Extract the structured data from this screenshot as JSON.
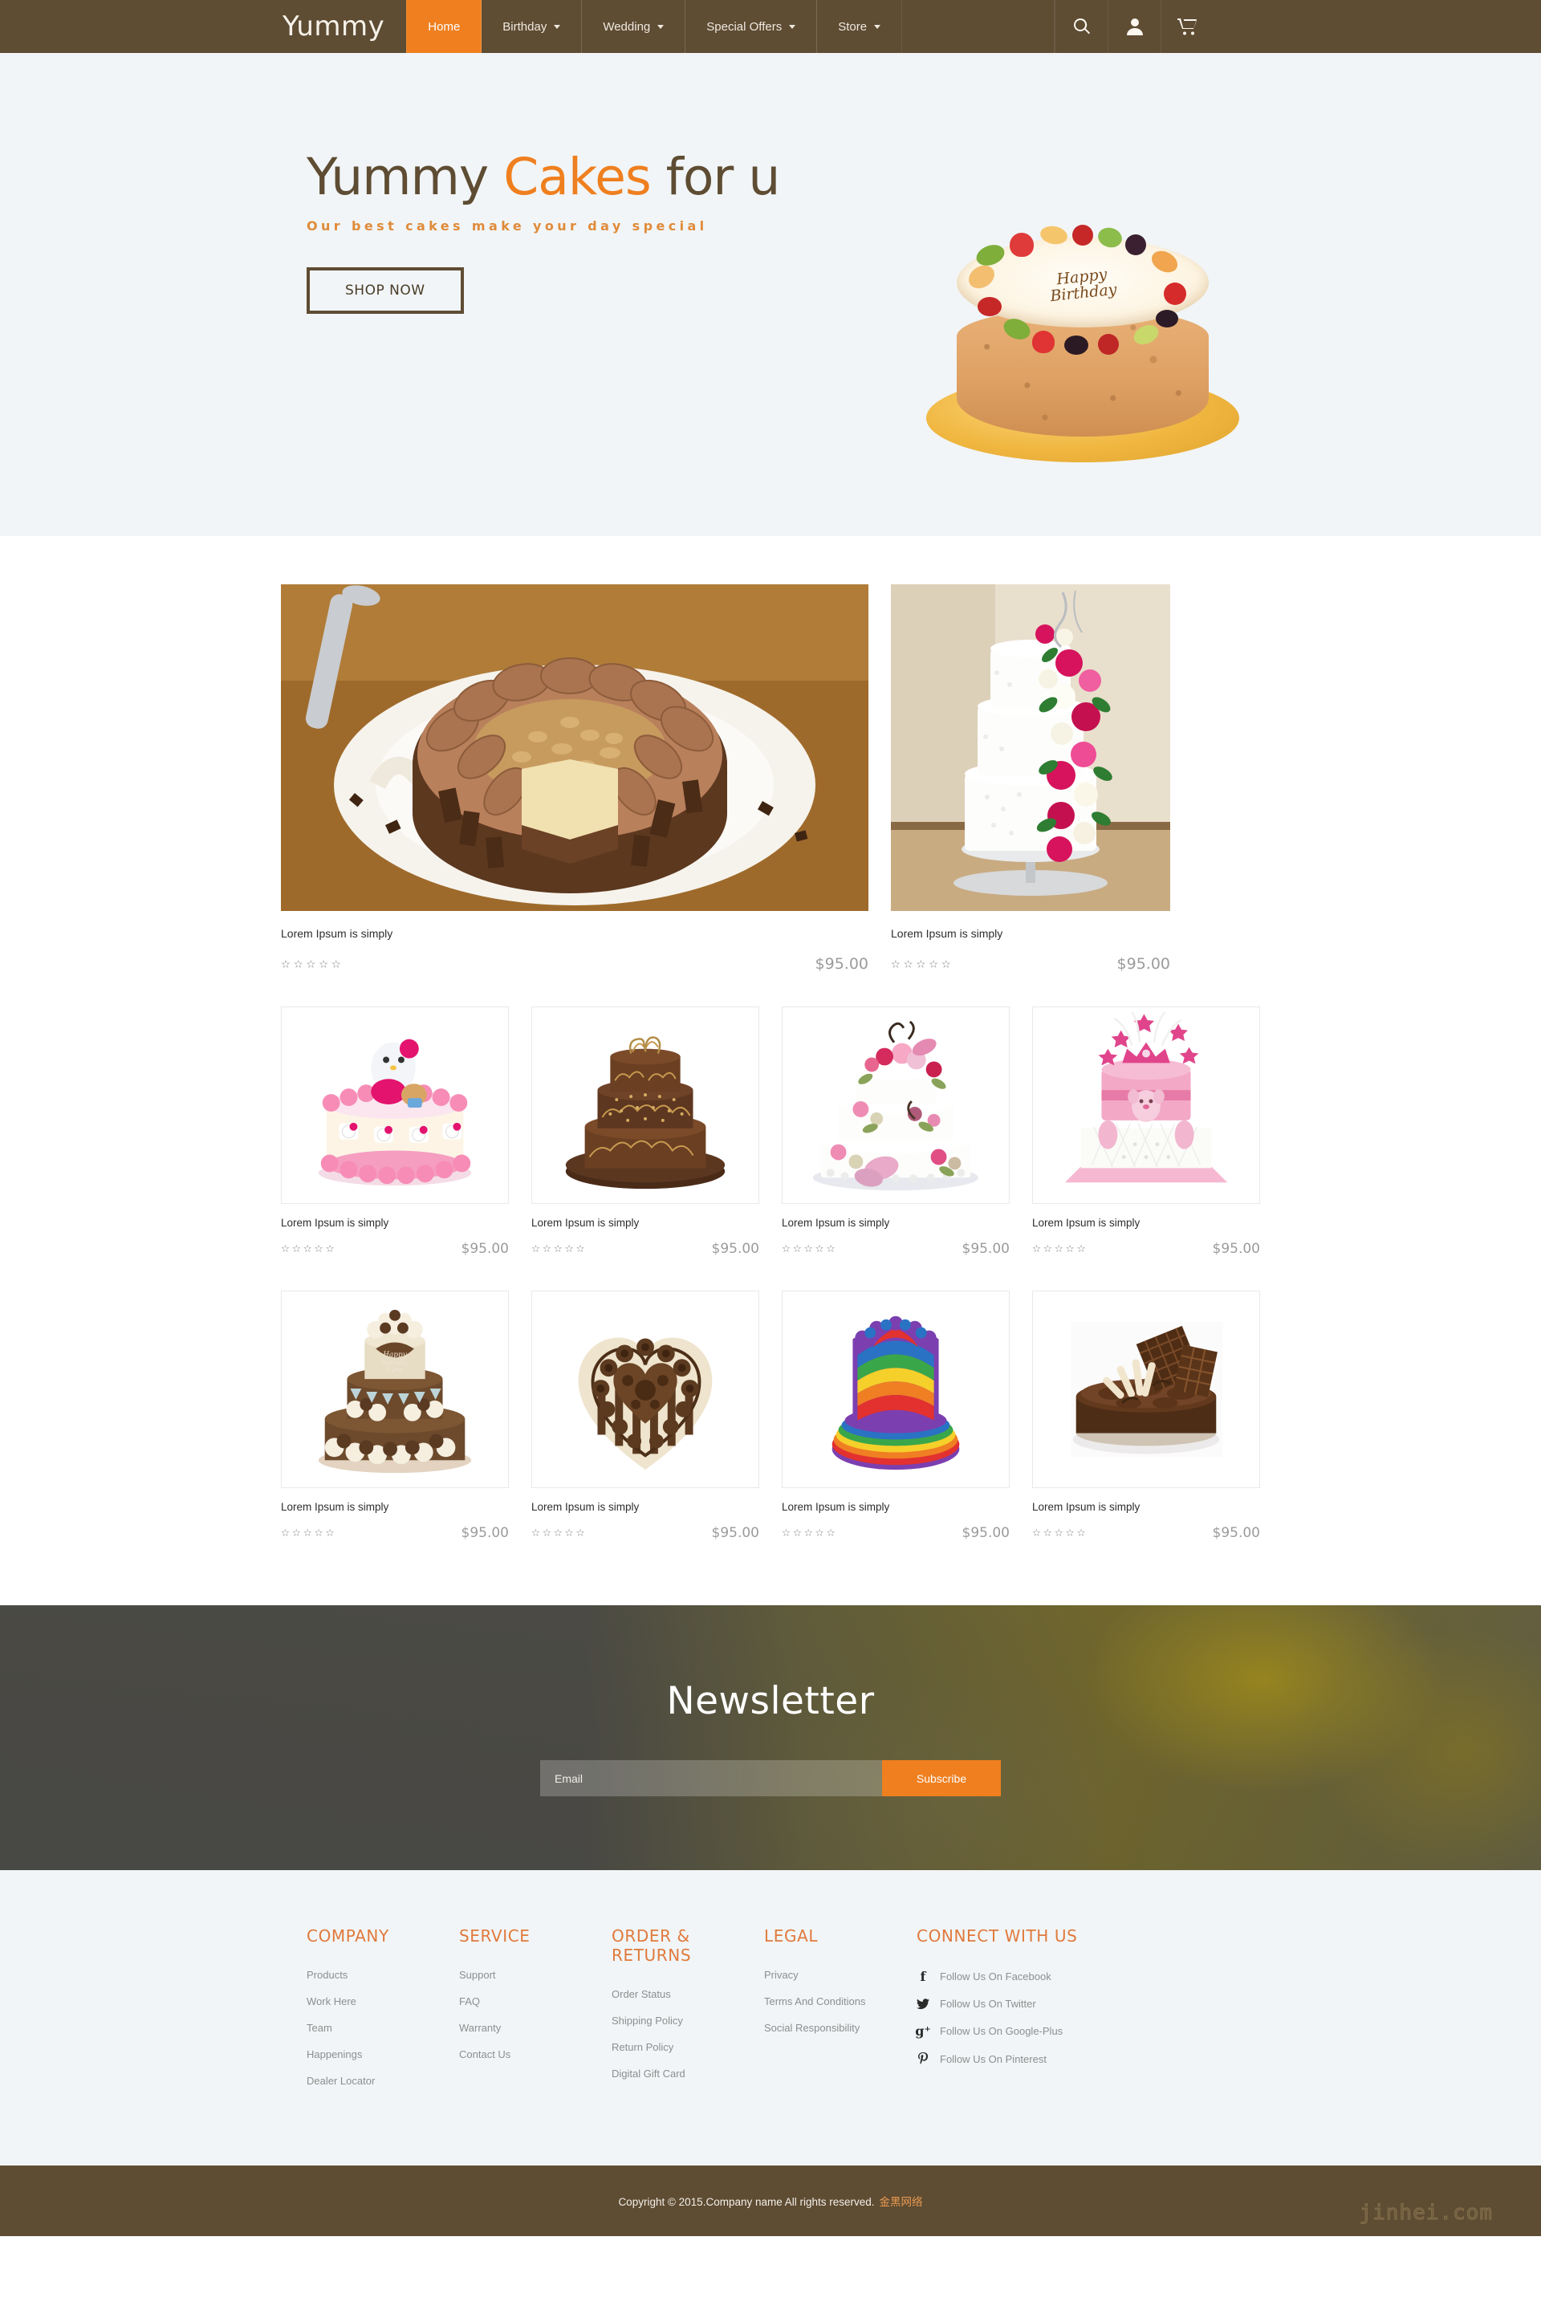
{
  "header": {
    "brand": "Yummy",
    "nav": [
      {
        "label": "Home",
        "has_caret": false,
        "active": true
      },
      {
        "label": "Birthday",
        "has_caret": true,
        "active": false
      },
      {
        "label": "Wedding",
        "has_caret": true,
        "active": false
      },
      {
        "label": "Special Offers",
        "has_caret": true,
        "active": false
      },
      {
        "label": "Store",
        "has_caret": true,
        "active": false
      }
    ],
    "icons": [
      "search-icon",
      "user-icon",
      "cart-icon"
    ],
    "accent_color": "#ef7f1f",
    "bar_color": "#5e4c33"
  },
  "hero": {
    "title_part1": "Yummy ",
    "title_accent": "Cakes",
    "title_part2": " for u",
    "subtitle": "Our best cakes make your day special",
    "button": "SHOP NOW",
    "cake_message_line1": "Happy",
    "cake_message_line2": "Birthday",
    "background_color": "#f1f5f7"
  },
  "products": {
    "featured": [
      {
        "title": "Lorem Ipsum is simply",
        "stars": "✫✫✫✫✫",
        "price": "$95.00",
        "art": "chocolate-sliced-cake"
      },
      {
        "title": "Lorem Ipsum is simply",
        "stars": "✫✫✫✫✫",
        "price": "$95.00",
        "art": "white-rose-wedding-cake"
      }
    ],
    "grid_row1": [
      {
        "title": "Lorem Ipsum is simply",
        "stars": "✫✫✫✫✫",
        "price": "$95.00",
        "art": "hello-kitty-pink-cake"
      },
      {
        "title": "Lorem Ipsum is simply",
        "stars": "✫✫✫✫✫",
        "price": "$95.00",
        "art": "brown-tiered-cake"
      },
      {
        "title": "Lorem Ipsum is simply",
        "stars": "✫✫✫✫✫",
        "price": "$95.00",
        "art": "white-floral-tiered-cake"
      },
      {
        "title": "Lorem Ipsum is simply",
        "stars": "✫✫✫✫✫",
        "price": "$95.00",
        "art": "pink-princess-cake"
      }
    ],
    "grid_row2": [
      {
        "title": "Lorem Ipsum is simply",
        "stars": "✫✫✫✫✫",
        "price": "$95.00",
        "art": "chocolate-birthday-cake"
      },
      {
        "title": "Lorem Ipsum is simply",
        "stars": "✫✫✫✫✫",
        "price": "$95.00",
        "art": "chocolate-heart-cake"
      },
      {
        "title": "Lorem Ipsum is simply",
        "stars": "✫✫✫✫✫",
        "price": "$95.00",
        "art": "rainbow-layer-cake"
      },
      {
        "title": "Lorem Ipsum is simply",
        "stars": "✫✫✫✫✫",
        "price": "$95.00",
        "art": "chocolate-shard-cake"
      }
    ]
  },
  "newsletter": {
    "title": "Newsletter",
    "email_placeholder": "Email",
    "email_value": "",
    "subscribe_label": "Subscribe",
    "button_color": "#ef7f1f"
  },
  "footer": {
    "columns": [
      {
        "heading": "COMPANY",
        "links": [
          "Products",
          "Work Here",
          "Team",
          "Happenings",
          "Dealer Locator"
        ]
      },
      {
        "heading": "SERVICE",
        "links": [
          "Support",
          "FAQ",
          "Warranty",
          "Contact Us"
        ]
      },
      {
        "heading": "ORDER & RETURNS",
        "links": [
          "Order Status",
          "Shipping Policy",
          "Return Policy",
          "Digital Gift Card"
        ]
      },
      {
        "heading": "LEGAL",
        "links": [
          "Privacy",
          "Terms And Conditions",
          "Social Responsibility"
        ]
      }
    ],
    "social": {
      "heading": "CONNECT WITH US",
      "items": [
        {
          "icon": "facebook-icon",
          "glyph": "f",
          "label": "Follow Us On Facebook"
        },
        {
          "icon": "twitter-icon",
          "glyph": "ᵛ",
          "label": "Follow Us On Twitter"
        },
        {
          "icon": "google-plus-icon",
          "glyph": "g⁺",
          "label": "Follow Us On Google-Plus"
        },
        {
          "icon": "pinterest-icon",
          "glyph": "р",
          "label": "Follow Us On Pinterest"
        }
      ]
    },
    "heading_color": "#e07a3c"
  },
  "copyright": {
    "text": "Copyright © 2015.Company name All rights reserved.",
    "cn_text": "金黑网络",
    "watermark": "jinhei.com"
  }
}
